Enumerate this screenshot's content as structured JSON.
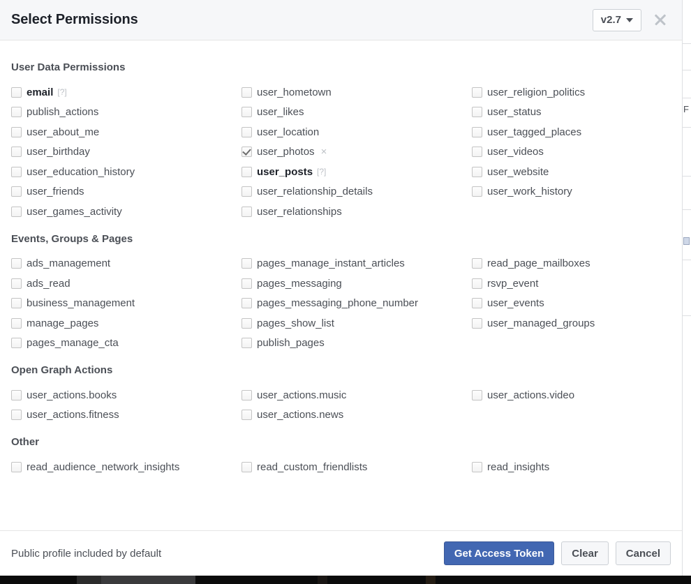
{
  "header": {
    "title": "Select Permissions",
    "version_label": "v2.7",
    "close_icon": "close-icon",
    "caret_icon": "chevron-down-icon"
  },
  "sections": [
    {
      "title": "User Data Permissions",
      "columns": [
        [
          {
            "label": "email",
            "checked": false,
            "bold": true,
            "help": "[?]"
          },
          {
            "label": "publish_actions",
            "checked": false,
            "bold": false
          },
          {
            "label": "user_about_me",
            "checked": false,
            "bold": false
          },
          {
            "label": "user_birthday",
            "checked": false,
            "bold": false
          },
          {
            "label": "user_education_history",
            "checked": false,
            "bold": false
          },
          {
            "label": "user_friends",
            "checked": false,
            "bold": false
          },
          {
            "label": "user_games_activity",
            "checked": false,
            "bold": false
          }
        ],
        [
          {
            "label": "user_hometown",
            "checked": false,
            "bold": false
          },
          {
            "label": "user_likes",
            "checked": false,
            "bold": false
          },
          {
            "label": "user_location",
            "checked": false,
            "bold": false
          },
          {
            "label": "user_photos",
            "checked": true,
            "bold": false,
            "remove": "×"
          },
          {
            "label": "user_posts",
            "checked": false,
            "bold": true,
            "help": "[?]"
          },
          {
            "label": "user_relationship_details",
            "checked": false,
            "bold": false
          },
          {
            "label": "user_relationships",
            "checked": false,
            "bold": false
          }
        ],
        [
          {
            "label": "user_religion_politics",
            "checked": false,
            "bold": false
          },
          {
            "label": "user_status",
            "checked": false,
            "bold": false
          },
          {
            "label": "user_tagged_places",
            "checked": false,
            "bold": false
          },
          {
            "label": "user_videos",
            "checked": false,
            "bold": false
          },
          {
            "label": "user_website",
            "checked": false,
            "bold": false
          },
          {
            "label": "user_work_history",
            "checked": false,
            "bold": false
          }
        ]
      ]
    },
    {
      "title": "Events, Groups & Pages",
      "columns": [
        [
          {
            "label": "ads_management",
            "checked": false,
            "bold": false
          },
          {
            "label": "ads_read",
            "checked": false,
            "bold": false
          },
          {
            "label": "business_management",
            "checked": false,
            "bold": false
          },
          {
            "label": "manage_pages",
            "checked": false,
            "bold": false
          },
          {
            "label": "pages_manage_cta",
            "checked": false,
            "bold": false
          }
        ],
        [
          {
            "label": "pages_manage_instant_articles",
            "checked": false,
            "bold": false
          },
          {
            "label": "pages_messaging",
            "checked": false,
            "bold": false
          },
          {
            "label": "pages_messaging_phone_number",
            "checked": false,
            "bold": false
          },
          {
            "label": "pages_show_list",
            "checked": false,
            "bold": false
          },
          {
            "label": "publish_pages",
            "checked": false,
            "bold": false
          }
        ],
        [
          {
            "label": "read_page_mailboxes",
            "checked": false,
            "bold": false
          },
          {
            "label": "rsvp_event",
            "checked": false,
            "bold": false
          },
          {
            "label": "user_events",
            "checked": false,
            "bold": false
          },
          {
            "label": "user_managed_groups",
            "checked": false,
            "bold": false
          }
        ]
      ]
    },
    {
      "title": "Open Graph Actions",
      "columns": [
        [
          {
            "label": "user_actions.books",
            "checked": false,
            "bold": false
          },
          {
            "label": "user_actions.fitness",
            "checked": false,
            "bold": false
          }
        ],
        [
          {
            "label": "user_actions.music",
            "checked": false,
            "bold": false
          },
          {
            "label": "user_actions.news",
            "checked": false,
            "bold": false
          }
        ],
        [
          {
            "label": "user_actions.video",
            "checked": false,
            "bold": false
          }
        ]
      ]
    },
    {
      "title": "Other",
      "columns": [
        [
          {
            "label": "read_audience_network_insights",
            "checked": false,
            "bold": false
          }
        ],
        [
          {
            "label": "read_custom_friendlists",
            "checked": false,
            "bold": false
          }
        ],
        [
          {
            "label": "read_insights",
            "checked": false,
            "bold": false
          }
        ]
      ]
    }
  ],
  "footer": {
    "note": "Public profile included by default",
    "primary_button": "Get Access Token",
    "clear_button": "Clear",
    "cancel_button": "Cancel"
  },
  "colors": {
    "primary": "#4267b2",
    "header_bg": "#f6f7f9",
    "text": "#4b4f56",
    "heading": "#1d2129"
  },
  "background_strip": {
    "glyph": "F"
  }
}
